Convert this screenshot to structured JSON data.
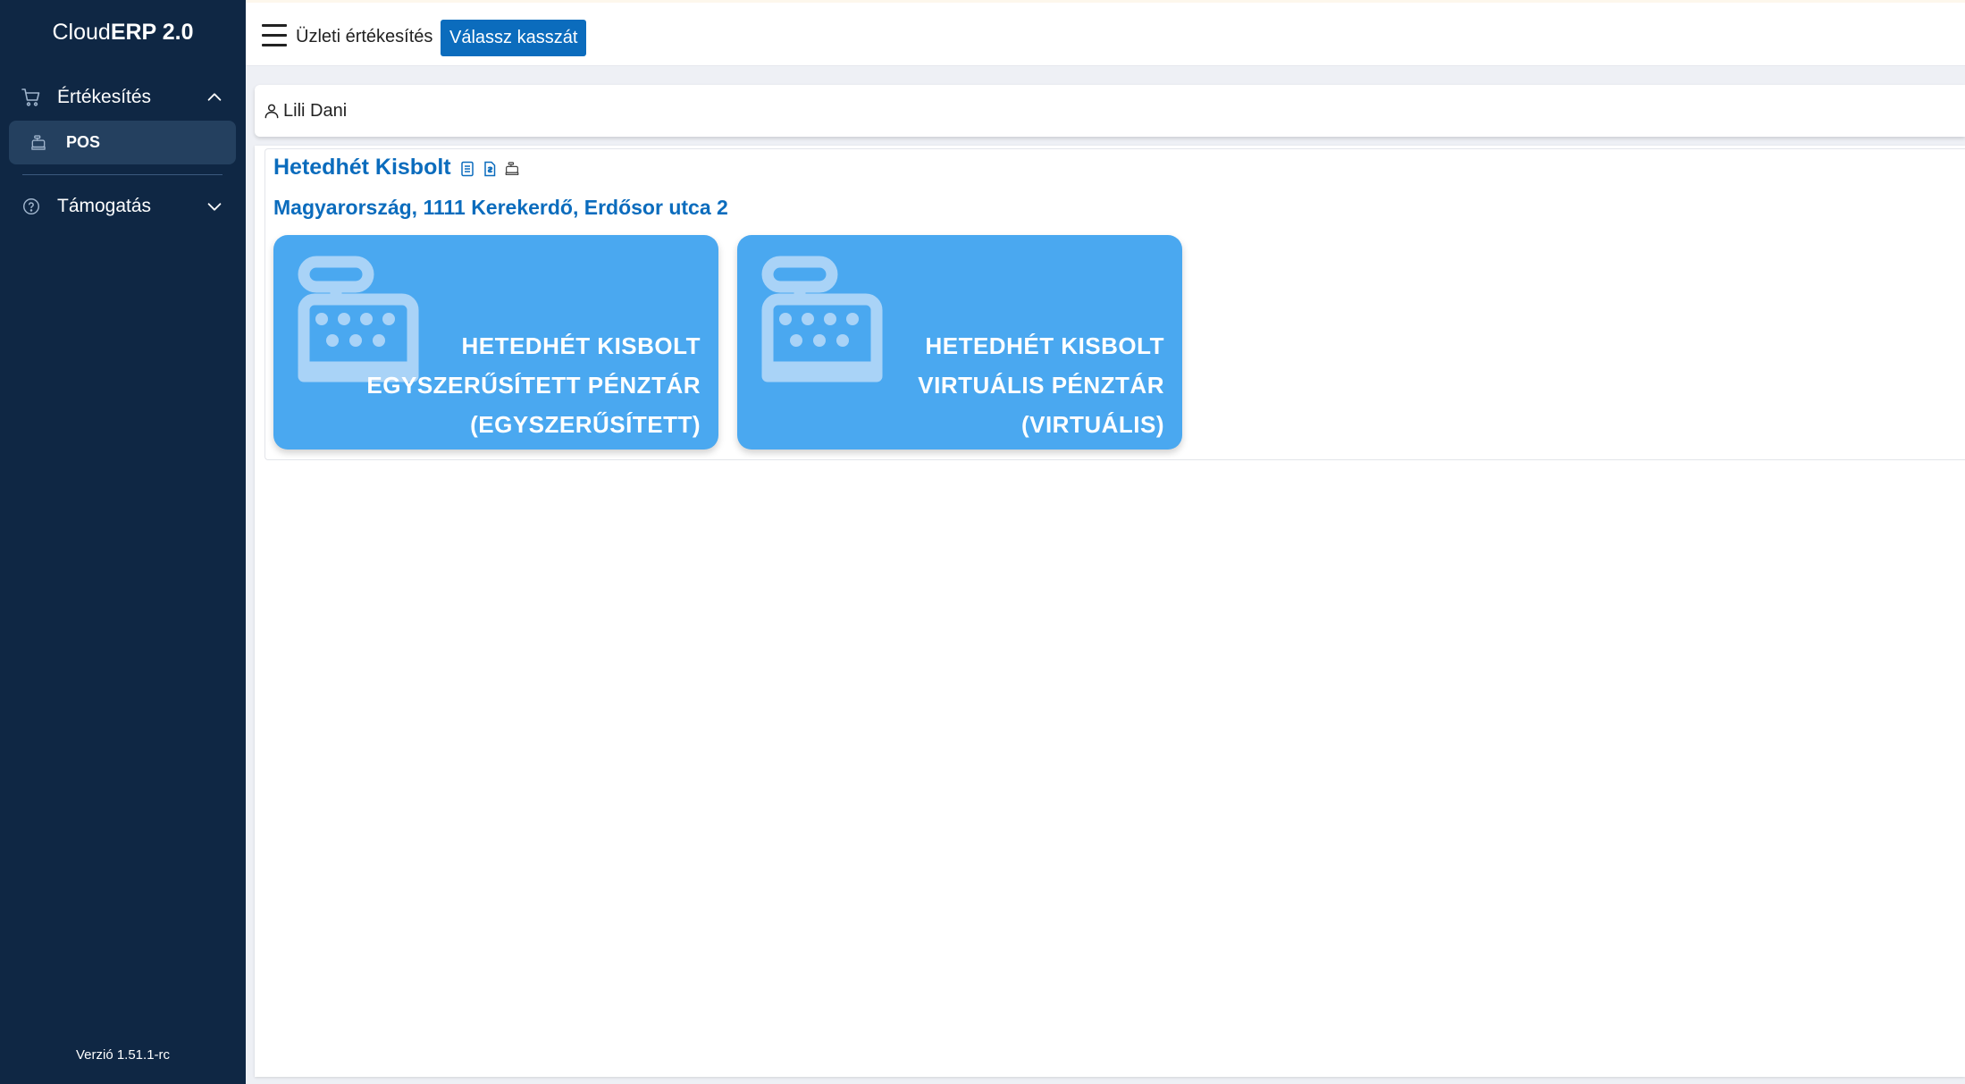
{
  "sidebar": {
    "brand_light": "Cloud",
    "brand_bold": "ERP 2.0",
    "groups": [
      {
        "label": "Értékesítés",
        "icon": "cart-icon",
        "expanded": true
      },
      {
        "label": "Támogatás",
        "icon": "help-circle-icon",
        "expanded": false
      }
    ],
    "items": [
      {
        "label": "POS",
        "icon": "cash-register-icon",
        "active": true
      }
    ],
    "version": "Verzió 1.51.1-rc"
  },
  "topbar": {
    "menu_icon": "hamburger-icon",
    "title": "Üzleti értékesítés",
    "choose_register_label": "Válassz kasszát"
  },
  "user": {
    "icon": "user-icon",
    "name": "Lili Dani"
  },
  "store": {
    "name": "Hetedhét Kisbolt",
    "icons": [
      "document-icon",
      "invoice-icon",
      "register-link-icon"
    ],
    "address": "Magyarország, 1111 Kerekerdő, Erdősor utca 2",
    "registers": [
      {
        "label": "HETEDHÉT KISBOLT EGYSZERŰSÍTETT PÉNZTÁR (EGYSZERŰSÍTETT)",
        "icon": "cash-register-icon"
      },
      {
        "label": "HETEDHÉT KISBOLT VIRTUÁLIS PÉNZTÁR (VIRTUÁLIS)",
        "icon": "cash-register-icon"
      }
    ]
  },
  "colors": {
    "sidebar_bg": "#0f2744",
    "sidebar_active": "#24405f",
    "accent": "#0b6cbd",
    "tile_bg": "#4aa8f0"
  }
}
